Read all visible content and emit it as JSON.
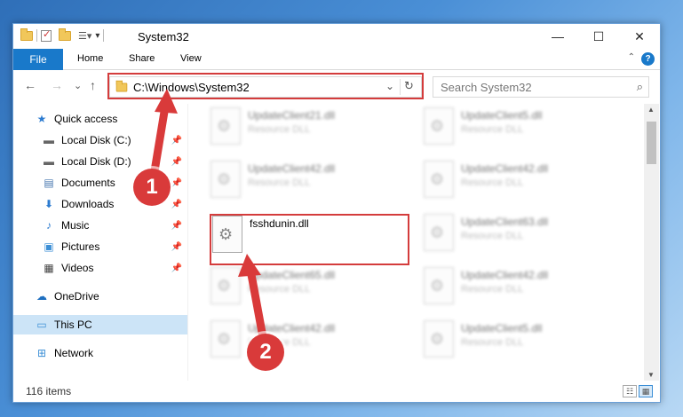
{
  "window": {
    "title": "System32",
    "controls": {
      "minimize": "—",
      "maximize": "☐",
      "close": "✕"
    }
  },
  "ribbon": {
    "file": "File",
    "home": "Home",
    "share": "Share",
    "view": "View",
    "help": "?"
  },
  "nav": {
    "back": "←",
    "forward": "→",
    "recent": "⌄",
    "up": "↑",
    "address": "C:\\Windows\\System32",
    "search_placeholder": "Search System32"
  },
  "sidebar": {
    "items": [
      {
        "label": "Quick access",
        "icon": "star-icon",
        "pinned": false
      },
      {
        "label": "Local Disk (C:)",
        "icon": "drive-icon",
        "pinned": true
      },
      {
        "label": "Local Disk (D:)",
        "icon": "drive-icon",
        "pinned": true
      },
      {
        "label": "Documents",
        "icon": "document-icon",
        "pinned": true
      },
      {
        "label": "Downloads",
        "icon": "download-icon",
        "pinned": true
      },
      {
        "label": "Music",
        "icon": "music-icon",
        "pinned": true
      },
      {
        "label": "Pictures",
        "icon": "pictures-icon",
        "pinned": true
      },
      {
        "label": "Videos",
        "icon": "video-icon",
        "pinned": true
      },
      {
        "label": "OneDrive",
        "icon": "cloud-icon",
        "pinned": false
      },
      {
        "label": "This PC",
        "icon": "computer-icon",
        "pinned": false,
        "selected": true
      },
      {
        "label": "Network",
        "icon": "network-icon",
        "pinned": false
      }
    ]
  },
  "files": [
    {
      "name": "UpdateClient21.dll",
      "type": "Resource DLL",
      "blurred": true
    },
    {
      "name": "UpdateClient5.dll",
      "type": "Resource DLL",
      "blurred": true
    },
    {
      "name": "UpdateClient42.dll",
      "type": "Resource DLL",
      "blurred": true
    },
    {
      "name": "UpdateClient42.dll",
      "type": "Resource DLL",
      "blurred": true
    },
    {
      "name": "fsshdunin.dll",
      "type": "",
      "blurred": false
    },
    {
      "name": "UpdateClient63.dll",
      "type": "Resource DLL",
      "blurred": true
    },
    {
      "name": "UpdateClient65.dll",
      "type": "Resource DLL",
      "blurred": true
    },
    {
      "name": "UpdateClient42.dll",
      "type": "Resource DLL",
      "blurred": true
    },
    {
      "name": "UpdateClient42.dll",
      "type": "Resource DLL",
      "blurred": true
    },
    {
      "name": "UpdateClient5.dll",
      "type": "Resource DLL",
      "blurred": true
    }
  ],
  "status": {
    "items": "116 items"
  },
  "annotations": {
    "step1": "1",
    "step2": "2",
    "color": "#d93a3a"
  }
}
